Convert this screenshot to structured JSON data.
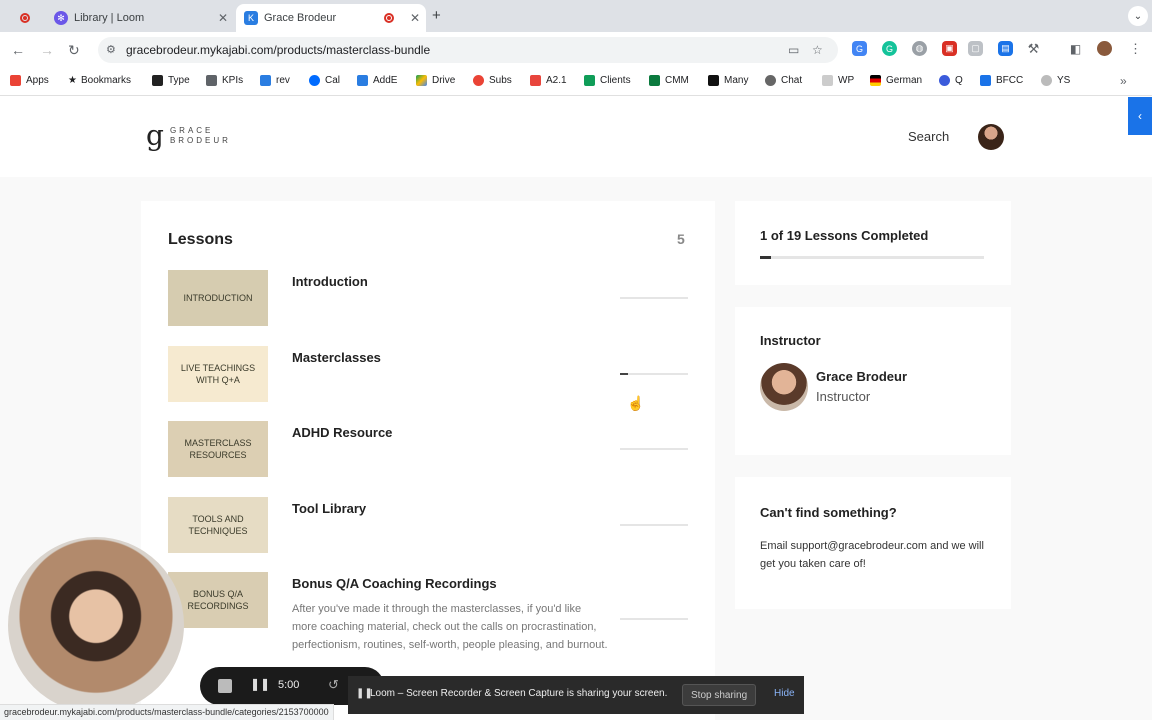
{
  "browser": {
    "tabs": [
      {
        "title": "Library | Loom",
        "active": false
      },
      {
        "title": "Grace Brodeur",
        "active": true
      }
    ],
    "url": "gracebrodeur.mykajabi.com/products/masterclass-bundle",
    "status_url": "gracebrodeur.mykajabi.com/products/masterclass-bundle/categories/2153700000",
    "bookmarks": [
      "Apps",
      "Bookmarks",
      "Type",
      "KPIs",
      "rev",
      "Cal",
      "AddE",
      "Drive",
      "Subs",
      "A2.1",
      "Clients",
      "CMM",
      "Many",
      "Chat",
      "WP",
      "German",
      "Q",
      "BFCC",
      "YS"
    ]
  },
  "site": {
    "logo_mark": "g",
    "logo_line1": "GRACE",
    "logo_line2": "BRODEUR",
    "search_label": "Search"
  },
  "lessons": {
    "title": "Lessons",
    "count": "5",
    "items": [
      {
        "thumb": "INTRODUCTION",
        "thumb_color": "#d6ccb0",
        "title": "Introduction",
        "desc": "",
        "progress": 0
      },
      {
        "thumb": "LIVE TEACHINGS WITH Q+A",
        "thumb_color": "#f6ead0",
        "title": "Masterclasses",
        "desc": "",
        "progress": 0.12
      },
      {
        "thumb": "MASTERCLASS RESOURCES",
        "thumb_color": "#dccfb3",
        "title": "ADHD Resource",
        "desc": "",
        "progress": 0
      },
      {
        "thumb": "TOOLS AND TECHNIQUES",
        "thumb_color": "#e6dcc4",
        "title": "Tool Library",
        "desc": "",
        "progress": 0
      },
      {
        "thumb": "BONUS Q/A RECORDINGS",
        "thumb_color": "#d9cdb2",
        "title": "Bonus Q/A Coaching Recordings",
        "desc": "After you've made it through the masterclasses, if you'd like more coaching material, check out the calls on procrastination, perfectionism, routines, self-worth, people pleasing, and burnout.",
        "progress": 0
      }
    ]
  },
  "completion": {
    "text": "1 of 19 Lessons Completed",
    "fraction": 0.05
  },
  "instructor": {
    "heading": "Instructor",
    "name": "Grace Brodeur",
    "role": "Instructor"
  },
  "help": {
    "heading": "Can't find something?",
    "text": "Email support@gracebrodeur.com and we will get you taken care of!"
  },
  "loom": {
    "time": "5:00",
    "share_text": "Loom – Screen Recorder & Screen Capture is sharing your screen.",
    "stop_sharing": "Stop sharing",
    "hide": "Hide"
  },
  "colors": {
    "accent_blue": "#1a73e8",
    "progress_dark": "#333333"
  }
}
